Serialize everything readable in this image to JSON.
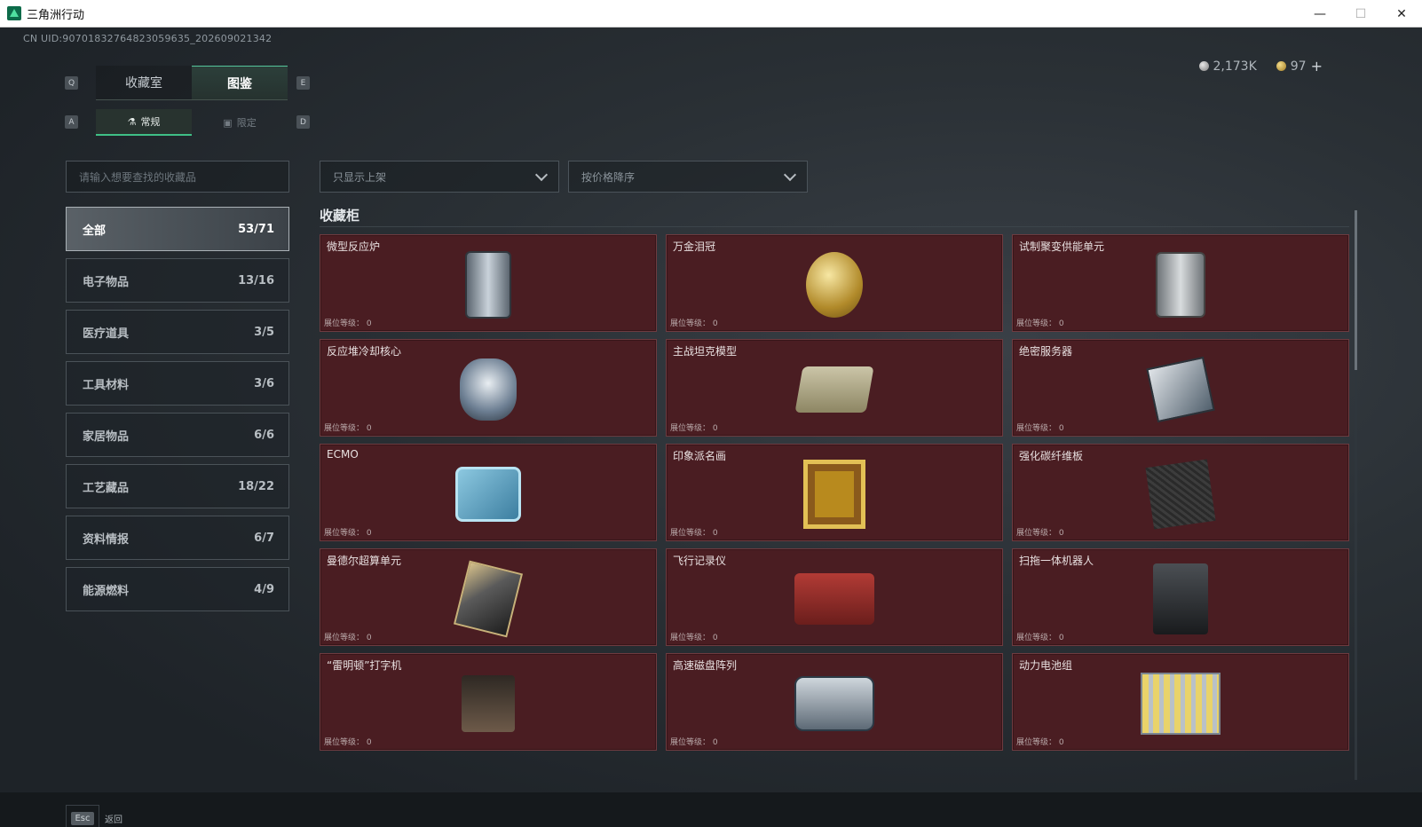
{
  "window": {
    "title": "三角洲行动",
    "minimize": "—",
    "maximize": "☐",
    "close": "✕"
  },
  "uid": "CN UID:9070183276482305963​5_202609021342",
  "currency": {
    "silver": "2,173K",
    "gold": "97",
    "add": "+"
  },
  "keys": {
    "q": "Q",
    "e": "E",
    "a": "A",
    "d": "D"
  },
  "tabs": [
    {
      "label": "收藏室",
      "active": false
    },
    {
      "label": "图鉴",
      "active": true
    }
  ],
  "subtabs": [
    {
      "label": "常规",
      "icon": "flask-icon",
      "active": true
    },
    {
      "label": "限定",
      "icon": "frame-icon",
      "active": false
    }
  ],
  "search": {
    "placeholder": "请输入想要查找的收藏品"
  },
  "filters": {
    "shelf": "只显示上架",
    "sort": "按价格降序"
  },
  "categories": [
    {
      "label": "全部",
      "count": "53/71",
      "active": true
    },
    {
      "label": "电子物品",
      "count": "13/16"
    },
    {
      "label": "医疗道具",
      "count": "3/5"
    },
    {
      "label": "工具材料",
      "count": "3/6"
    },
    {
      "label": "家居物品",
      "count": "6/6"
    },
    {
      "label": "工艺藏品",
      "count": "18/22"
    },
    {
      "label": "资料情报",
      "count": "6/7"
    },
    {
      "label": "能源燃料",
      "count": "4/9"
    }
  ],
  "section_title": "收藏柜",
  "level_prefix": "展位等级：",
  "items": [
    {
      "name": "微型反应炉",
      "level": "展位等级： 0",
      "art": "reactor"
    },
    {
      "name": "万金泪冠",
      "level": "展位等级： 0",
      "art": "egg"
    },
    {
      "name": "试制聚变供能单元",
      "level": "展位等级： 0",
      "art": "unit"
    },
    {
      "name": "反应堆冷却核心",
      "level": "展位等级： 0",
      "art": "core"
    },
    {
      "name": "主战坦克模型",
      "level": "展位等级： 0",
      "art": "tank"
    },
    {
      "name": "绝密服务器",
      "level": "展位等级： 0",
      "art": "server"
    },
    {
      "name": "ECMO",
      "level": "展位等级： 0",
      "art": "ecmo"
    },
    {
      "name": "印象派名画",
      "level": "展位等级： 0",
      "art": "painting"
    },
    {
      "name": "强化碳纤维板",
      "level": "展位等级： 0",
      "art": "carbon"
    },
    {
      "name": "曼德尔超算单元",
      "level": "展位等级： 0",
      "art": "chip"
    },
    {
      "name": "飞行记录仪",
      "level": "展位等级： 0",
      "art": "recorder"
    },
    {
      "name": "扫拖一体机器人",
      "level": "展位等级： 0",
      "art": "robot"
    },
    {
      "name": "“雷明顿”打字机",
      "level": "展位等级： 0",
      "art": "typewriter"
    },
    {
      "name": "高速磁盘阵列",
      "level": "展位等级： 0",
      "art": "disk"
    },
    {
      "name": "动力电池组",
      "level": "展位等级： 0",
      "art": "battery"
    }
  ],
  "footer": {
    "esc_key": "Esc",
    "esc_label": "返回"
  }
}
